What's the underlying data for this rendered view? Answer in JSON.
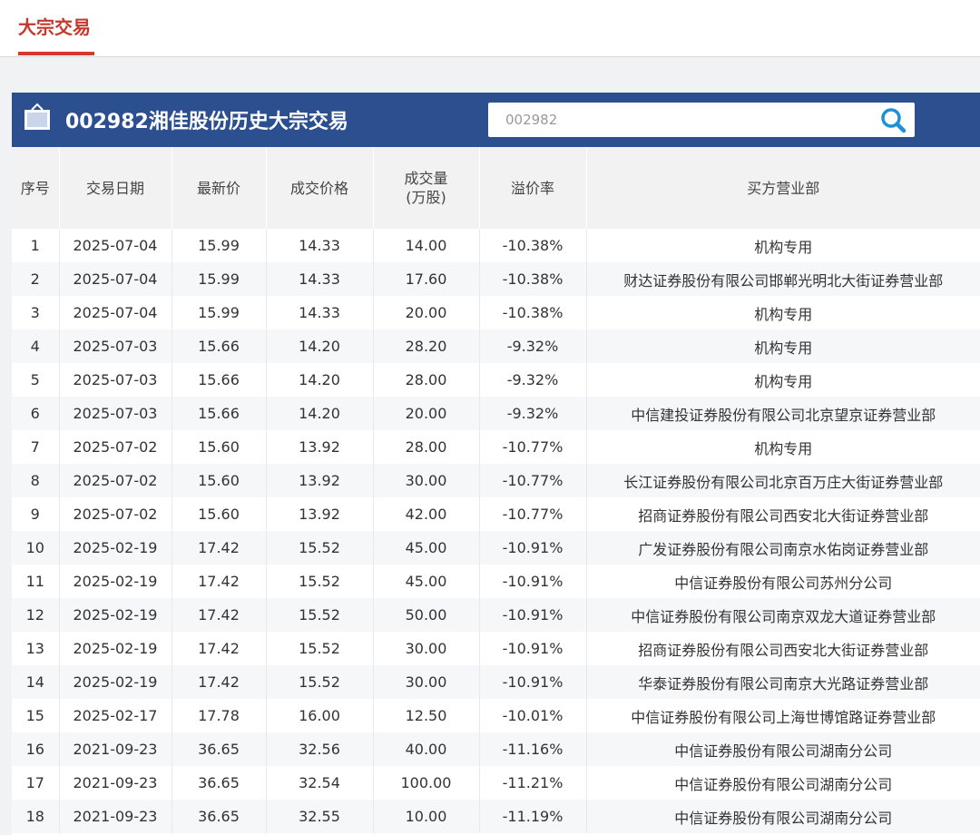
{
  "tab": {
    "label": "大宗交易"
  },
  "panel": {
    "title": "002982湘佳股份历史大宗交易"
  },
  "search": {
    "value": "002982",
    "placeholder": "002982"
  },
  "table": {
    "headers": {
      "index": "序号",
      "date": "交易日期",
      "latest": "最新价",
      "deal_price": "成交价格",
      "volume_line1": "成交量",
      "volume_line2": "(万股)",
      "premium": "溢价率",
      "buyer": "买方营业部"
    },
    "rows": [
      {
        "index": "1",
        "date": "2025-07-04",
        "latest": "15.99",
        "deal_price": "14.33",
        "volume": "14.00",
        "premium": "-10.38%",
        "buyer": "机构专用"
      },
      {
        "index": "2",
        "date": "2025-07-04",
        "latest": "15.99",
        "deal_price": "14.33",
        "volume": "17.60",
        "premium": "-10.38%",
        "buyer": "财达证券股份有限公司邯郸光明北大街证券营业部"
      },
      {
        "index": "3",
        "date": "2025-07-04",
        "latest": "15.99",
        "deal_price": "14.33",
        "volume": "20.00",
        "premium": "-10.38%",
        "buyer": "机构专用"
      },
      {
        "index": "4",
        "date": "2025-07-03",
        "latest": "15.66",
        "deal_price": "14.20",
        "volume": "28.20",
        "premium": "-9.32%",
        "buyer": "机构专用"
      },
      {
        "index": "5",
        "date": "2025-07-03",
        "latest": "15.66",
        "deal_price": "14.20",
        "volume": "28.00",
        "premium": "-9.32%",
        "buyer": "机构专用"
      },
      {
        "index": "6",
        "date": "2025-07-03",
        "latest": "15.66",
        "deal_price": "14.20",
        "volume": "20.00",
        "premium": "-9.32%",
        "buyer": "中信建投证券股份有限公司北京望京证券营业部"
      },
      {
        "index": "7",
        "date": "2025-07-02",
        "latest": "15.60",
        "deal_price": "13.92",
        "volume": "28.00",
        "premium": "-10.77%",
        "buyer": "机构专用"
      },
      {
        "index": "8",
        "date": "2025-07-02",
        "latest": "15.60",
        "deal_price": "13.92",
        "volume": "30.00",
        "premium": "-10.77%",
        "buyer": "长江证券股份有限公司北京百万庄大街证券营业部"
      },
      {
        "index": "9",
        "date": "2025-07-02",
        "latest": "15.60",
        "deal_price": "13.92",
        "volume": "42.00",
        "premium": "-10.77%",
        "buyer": "招商证券股份有限公司西安北大街证券营业部"
      },
      {
        "index": "10",
        "date": "2025-02-19",
        "latest": "17.42",
        "deal_price": "15.52",
        "volume": "45.00",
        "premium": "-10.91%",
        "buyer": "广发证券股份有限公司南京水佑岗证券营业部"
      },
      {
        "index": "11",
        "date": "2025-02-19",
        "latest": "17.42",
        "deal_price": "15.52",
        "volume": "45.00",
        "premium": "-10.91%",
        "buyer": "中信证券股份有限公司苏州分公司"
      },
      {
        "index": "12",
        "date": "2025-02-19",
        "latest": "17.42",
        "deal_price": "15.52",
        "volume": "50.00",
        "premium": "-10.91%",
        "buyer": "中信证券股份有限公司南京双龙大道证券营业部"
      },
      {
        "index": "13",
        "date": "2025-02-19",
        "latest": "17.42",
        "deal_price": "15.52",
        "volume": "30.00",
        "premium": "-10.91%",
        "buyer": "招商证券股份有限公司西安北大街证券营业部"
      },
      {
        "index": "14",
        "date": "2025-02-19",
        "latest": "17.42",
        "deal_price": "15.52",
        "volume": "30.00",
        "premium": "-10.91%",
        "buyer": "华泰证券股份有限公司南京大光路证券营业部"
      },
      {
        "index": "15",
        "date": "2025-02-17",
        "latest": "17.78",
        "deal_price": "16.00",
        "volume": "12.50",
        "premium": "-10.01%",
        "buyer": "中信证券股份有限公司上海世博馆路证券营业部"
      },
      {
        "index": "16",
        "date": "2021-09-23",
        "latest": "36.65",
        "deal_price": "32.56",
        "volume": "40.00",
        "premium": "-11.16%",
        "buyer": "中信证券股份有限公司湖南分公司"
      },
      {
        "index": "17",
        "date": "2021-09-23",
        "latest": "36.65",
        "deal_price": "32.54",
        "volume": "100.00",
        "premium": "-11.21%",
        "buyer": "中信证券股份有限公司湖南分公司"
      },
      {
        "index": "18",
        "date": "2021-09-23",
        "latest": "36.65",
        "deal_price": "32.55",
        "volume": "10.00",
        "premium": "-11.19%",
        "buyer": "中信证券股份有限公司湖南分公司"
      }
    ]
  },
  "colors": {
    "accent": "#c7372b",
    "header_bar": "#2b4f8f",
    "price_red": "#d23a2c",
    "premium_green": "#2e9c4b"
  },
  "icons": {
    "header": "stock-board-icon",
    "search": "search-icon"
  }
}
